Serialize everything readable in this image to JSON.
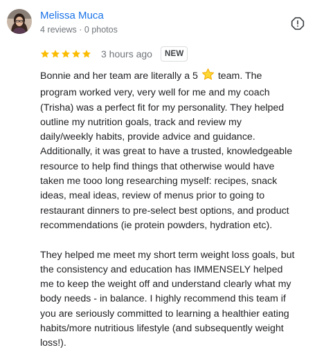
{
  "review": {
    "author": {
      "name": "Melissa Muca",
      "meta": "4 reviews · 0 photos"
    },
    "rating": 5,
    "time_ago": "3 hours ago",
    "badge": "NEW",
    "icons": {
      "flag": "report-flag-icon",
      "star": "star-icon"
    },
    "colors": {
      "name": "#1a73e8",
      "star": "#fbbc04",
      "muted": "#70757a"
    },
    "text": {
      "p1_l1_before": "Bonnie and her team are literally a 5",
      "p1_l1_after": "team. The",
      "p1_lines": [
        "program worked very, very well for me and my coach",
        "(Trisha) was a perfect fit for my personality. They helped",
        "outline my nutrition goals, track and review my",
        "daily/weekly habits, provide advice and guidance.",
        "Additionally, it was great to have a trusted, knowledgeable",
        "resource to help find things that otherwise would have",
        "taken me tooo long researching myself: recipes, snack",
        "ideas, meal ideas, review of menus prior to going to",
        "restaurant dinners to pre-select best options, and product",
        "recommendations (ie protein powders, hydration etc)."
      ],
      "p2_lines": [
        "They helped me meet my short term weight loss goals, but",
        "the consistency and education has IMMENSELY helped",
        "me to keep the weight off and understand clearly what my",
        "body needs - in balance. I highly recommend this team if",
        "you are seriously committed to learning a healthier eating",
        "habits/more nutritious lifestyle (and subsequently weight",
        "loss!)."
      ]
    }
  }
}
